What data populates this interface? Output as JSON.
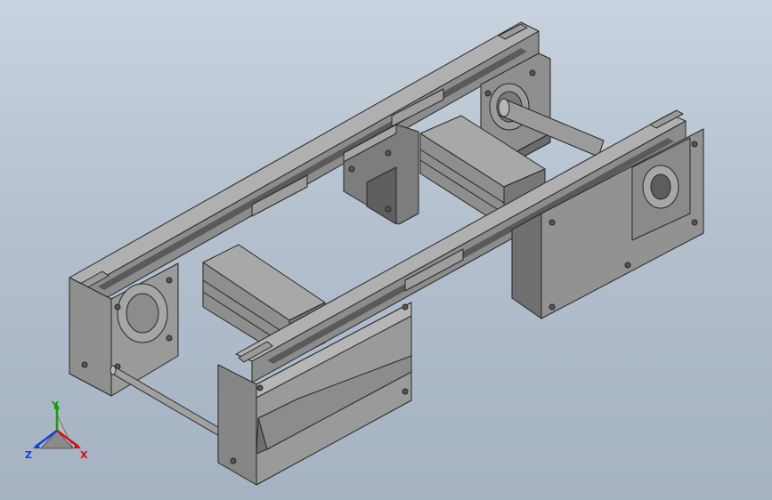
{
  "colors": {
    "background_top": "#c9d3df",
    "background_bottom": "#a5b2c2",
    "part_light": "#a3a3a3",
    "part_mid": "#878787",
    "part_dark": "#6b6b6b",
    "edge": "#262626",
    "axis_x": "#d01010",
    "axis_y": "#10a010",
    "axis_z": "#1a3fd0"
  },
  "triad": {
    "x_label": "X",
    "y_label": "Y",
    "z_label": "Z"
  }
}
